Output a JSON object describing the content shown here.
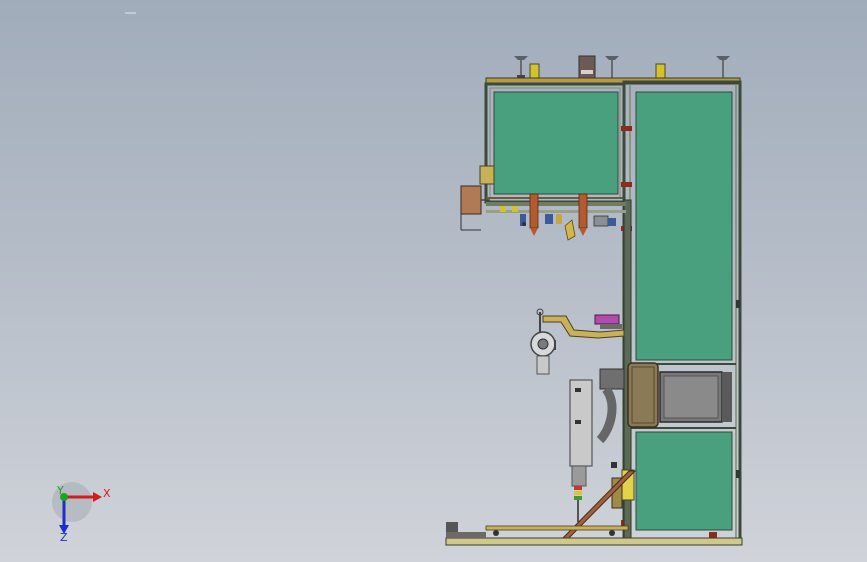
{
  "triad": {
    "x_label": "X",
    "y_label": "Y",
    "z_label": "Z",
    "x_color": "#d21d1d",
    "y_color": "#1fa31f",
    "z_color": "#1d2fc8"
  },
  "colors": {
    "panel_fill": "#49a07e",
    "frame": "#3c4a3a",
    "frame_light": "#7e8a6e",
    "brass": "#c9a447",
    "copper": "#b35a2e",
    "rust": "#a0613e",
    "magenta": "#b14aa8",
    "gray_block": "#6f6f6f",
    "dark_gray": "#4c4c4c",
    "light_gray": "#b9b9b9"
  }
}
